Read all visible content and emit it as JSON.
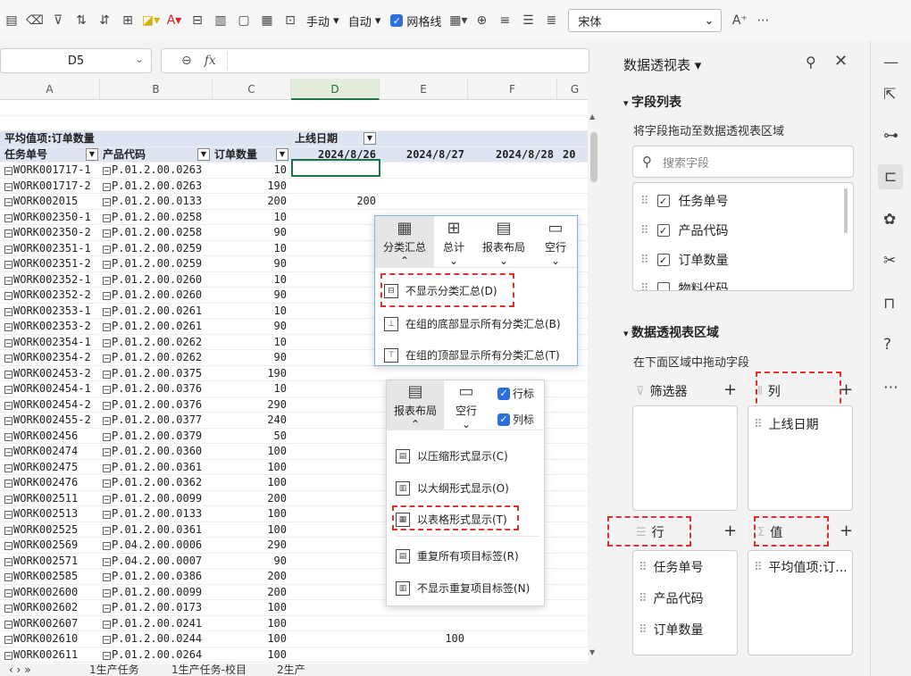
{
  "toolbar": {
    "manual_label": "手动",
    "auto_label": "自动",
    "gridlines_label": "网格线",
    "font_name": "宋体"
  },
  "formula": {
    "cell_ref": "D5",
    "fx_label": "fx"
  },
  "columns": [
    "A",
    "B",
    "C",
    "D",
    "E",
    "F",
    "G"
  ],
  "pivot": {
    "header_label": "平均值项:订单数量",
    "col_field": "上线日期",
    "row_header_1": "任务单号",
    "row_header_2": "产品代码",
    "row_header_3": "订单数量",
    "dates": [
      "2024/8/26",
      "2024/8/27",
      "2024/8/28",
      "20"
    ],
    "rows": [
      {
        "a": "WORK001717-1",
        "b": "P.01.2.00.0263",
        "c": "10",
        "d": ""
      },
      {
        "a": "WORK001717-2",
        "b": "P.01.2.00.0263",
        "c": "190",
        "d": ""
      },
      {
        "a": "WORK002015",
        "b": "P.01.2.00.0133",
        "c": "200",
        "d": "200"
      },
      {
        "a": "WORK002350-1",
        "b": "P.01.2.00.0258",
        "c": "10",
        "d": ""
      },
      {
        "a": "WORK002350-2",
        "b": "P.01.2.00.0258",
        "c": "90",
        "d": ""
      },
      {
        "a": "WORK002351-1",
        "b": "P.01.2.00.0259",
        "c": "10",
        "d": ""
      },
      {
        "a": "WORK002351-2",
        "b": "P.01.2.00.0259",
        "c": "90",
        "d": ""
      },
      {
        "a": "WORK002352-1",
        "b": "P.01.2.00.0260",
        "c": "10",
        "d": ""
      },
      {
        "a": "WORK002352-2",
        "b": "P.01.2.00.0260",
        "c": "90",
        "d": ""
      },
      {
        "a": "WORK002353-1",
        "b": "P.01.2.00.0261",
        "c": "10",
        "d": ""
      },
      {
        "a": "WORK002353-2",
        "b": "P.01.2.00.0261",
        "c": "90",
        "d": ""
      },
      {
        "a": "WORK002354-1",
        "b": "P.01.2.00.0262",
        "c": "10",
        "d": ""
      },
      {
        "a": "WORK002354-2",
        "b": "P.01.2.00.0262",
        "c": "90",
        "d": ""
      },
      {
        "a": "WORK002453-2",
        "b": "P.01.2.00.0375",
        "c": "190",
        "d": ""
      },
      {
        "a": "WORK002454-1",
        "b": "P.01.2.00.0376",
        "c": "10",
        "d": ""
      },
      {
        "a": "WORK002454-2",
        "b": "P.01.2.00.0376",
        "c": "290",
        "d": ""
      },
      {
        "a": "WORK002455-2",
        "b": "P.01.2.00.0377",
        "c": "240",
        "d": ""
      },
      {
        "a": "WORK002456",
        "b": "P.01.2.00.0379",
        "c": "50",
        "d": ""
      },
      {
        "a": "WORK002474",
        "b": "P.01.2.00.0360",
        "c": "100",
        "d": ""
      },
      {
        "a": "WORK002475",
        "b": "P.01.2.00.0361",
        "c": "100",
        "d": ""
      },
      {
        "a": "WORK002476",
        "b": "P.01.2.00.0362",
        "c": "100",
        "d": ""
      },
      {
        "a": "WORK002511",
        "b": "P.01.2.00.0099",
        "c": "200",
        "d": ""
      },
      {
        "a": "WORK002513",
        "b": "P.01.2.00.0133",
        "c": "100",
        "d": ""
      },
      {
        "a": "WORK002525",
        "b": "P.01.2.00.0361",
        "c": "100",
        "d": ""
      },
      {
        "a": "WORK002569",
        "b": "P.04.2.00.0006",
        "c": "290",
        "d": ""
      },
      {
        "a": "WORK002571",
        "b": "P.04.2.00.0007",
        "c": "90",
        "d": ""
      },
      {
        "a": "WORK002585",
        "b": "P.01.2.00.0386",
        "c": "200",
        "d": ""
      },
      {
        "a": "WORK002600",
        "b": "P.01.2.00.0099",
        "c": "200",
        "d": ""
      },
      {
        "a": "WORK002602",
        "b": "P.01.2.00.0173",
        "c": "100",
        "d": ""
      },
      {
        "a": "WORK002607",
        "b": "P.01.2.00.0241",
        "c": "100",
        "d": ""
      },
      {
        "a": "WORK002610",
        "b": "P.01.2.00.0244",
        "c": "100",
        "d": "",
        "e": "100"
      },
      {
        "a": "WORK002611",
        "b": "P.01.2.00.0264",
        "c": "100",
        "d": ""
      }
    ]
  },
  "popup_subtotal": {
    "tabs": [
      "分类汇总",
      "总计",
      "报表布局",
      "空行"
    ],
    "items": [
      "不显示分类汇总(D)",
      "在组的底部显示所有分类汇总(B)",
      "在组的顶部显示所有分类汇总(T)"
    ]
  },
  "popup_layout": {
    "tabs": [
      "报表布局",
      "空行"
    ],
    "checks": [
      "行标",
      "列标"
    ],
    "items": [
      "以压缩形式显示(C)",
      "以大纲形式显示(O)",
      "以表格形式显示(T)",
      "重复所有项目标签(R)",
      "不显示重复项目标签(N)"
    ]
  },
  "sheet_tabs": [
    "1生产任务",
    "1生产任务-校目",
    "2生产"
  ],
  "panel": {
    "title": "数据透视表",
    "field_list_title": "字段列表",
    "field_list_hint": "将字段拖动至数据透视表区域",
    "search_placeholder": "搜索字段",
    "fields": [
      {
        "name": "任务单号",
        "checked": true
      },
      {
        "name": "产品代码",
        "checked": true
      },
      {
        "name": "订单数量",
        "checked": true
      },
      {
        "name": "物料代码",
        "checked": false
      }
    ],
    "area_title": "数据透视表区域",
    "area_hint": "在下面区域中拖动字段",
    "filter_label": "筛选器",
    "column_label": "列",
    "row_label": "行",
    "value_label": "值",
    "column_items": [
      "上线日期"
    ],
    "row_items": [
      "任务单号",
      "产品代码",
      "订单数量"
    ],
    "value_items": [
      "平均值项:订..."
    ]
  }
}
